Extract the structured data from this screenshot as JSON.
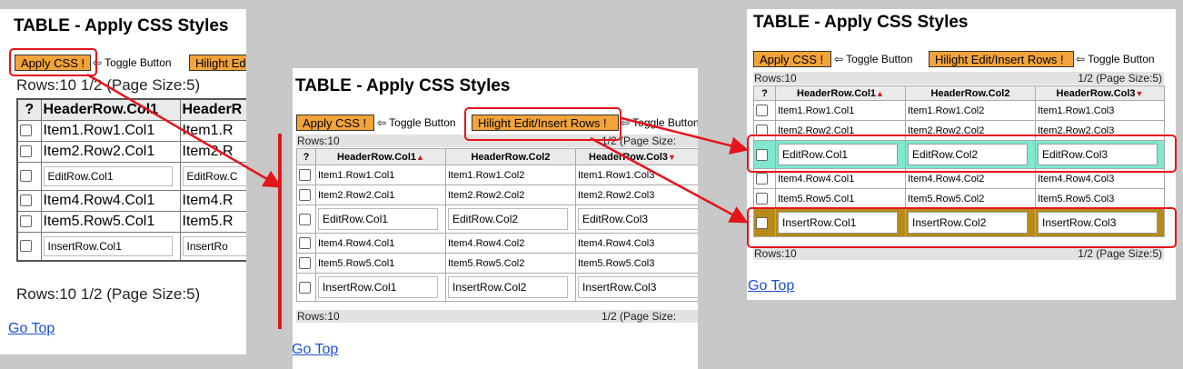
{
  "colors": {
    "button": "#f2a33a",
    "highlight": "#e4141b",
    "edit_row": "#7fe8cf",
    "insert_row": "#b78a17",
    "link": "#1a4fd8"
  },
  "title": "TABLE - Apply CSS Styles",
  "apply_css_label": "Apply CSS !",
  "toggle_label": "⇦ Toggle Button",
  "hilight_label": "Hilight Edit/Insert Rows !",
  "hilight_label_cut": "Hilight Edi",
  "rows_label": "Rows:10",
  "rows_info_full": "Rows:10 1/2 (Page Size:5)",
  "page_label": "1/2 (Page Size:5)",
  "page_label_cut": "1/2 (Page Size:",
  "goto_top": "Go Top",
  "head": {
    "check": "?",
    "col1": "HeaderRow.Col1",
    "col2": "HeaderRow.Col2",
    "col3": "HeaderRow.Col3",
    "col2_cut": "HeaderR"
  },
  "rows": {
    "r1": {
      "c1": "Item1.Row1.Col1",
      "c2": "Item1.Row1.Col2",
      "c3": "Item1.Row1.Col3",
      "c2_cut": "Item1.R"
    },
    "r2": {
      "c1": "Item2.Row2.Col1",
      "c2": "Item2.Row2.Col2",
      "c3": "Item2.Row2.Col3",
      "c2_cut": "Item2.R"
    },
    "edit": {
      "c1": "EditRow.Col1",
      "c2": "EditRow.Col2",
      "c3": "EditRow.Col3",
      "c2_cut": "EditRow.C"
    },
    "r4": {
      "c1": "Item4.Row4.Col1",
      "c2": "Item4.Row4.Col2",
      "c3": "Item4.Row4.Col3",
      "c2_cut": "Item4.R"
    },
    "r5": {
      "c1": "Item5.Row5.Col1",
      "c2": "Item5.Row5.Col2",
      "c3": "Item5.Row5.Col3",
      "c2_cut": "Item5.R"
    },
    "ins": {
      "c1": "InsertRow.Col1",
      "c2": "InsertRow.Col2",
      "c3": "InsertRow.Col3",
      "c2_cut": "InsertRo"
    }
  },
  "sort_asc_glyph": "▲",
  "sort_desc_glyph": "▼"
}
